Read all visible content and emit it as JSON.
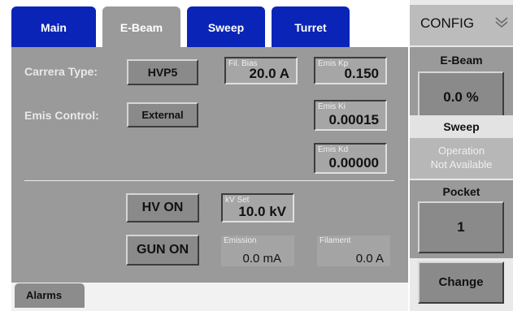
{
  "tabs": [
    {
      "label": "Main",
      "active": false
    },
    {
      "label": "E-Beam",
      "active": true
    },
    {
      "label": "Sweep",
      "active": false
    },
    {
      "label": "Turret",
      "active": false
    }
  ],
  "ebeam": {
    "carrera_label": "Carrera Type:",
    "carrera_value": "HVP5",
    "emis_control_label": "Emis Control:",
    "emis_control_value": "External",
    "fil_bias": {
      "caption": "Fil. Bias",
      "value": "20.0 A"
    },
    "emis_kp": {
      "caption": "Emis Kp",
      "value": "0.150"
    },
    "emis_ki": {
      "caption": "Emis Ki",
      "value": "0.00015"
    },
    "emis_kd": {
      "caption": "Emis Kd",
      "value": "0.00000"
    },
    "hv_on": "HV ON",
    "gun_on": "GUN ON",
    "kv_set": {
      "caption": "kV Set",
      "value": "10.0 kV"
    },
    "emission": {
      "caption": "Emission",
      "value": "0.0 mA"
    },
    "filament": {
      "caption": "Filament",
      "value": "0.0 A"
    }
  },
  "bottom": {
    "alarms_label": "Alarms"
  },
  "sidebar": {
    "config_label": "CONFIG",
    "ebeam_header": "E-Beam",
    "ebeam_value": "0.0 %",
    "sweep_header": "Sweep",
    "sweep_status_line1": "Operation",
    "sweep_status_line2": "Not Available",
    "pocket_header": "Pocket",
    "pocket_value": "1",
    "change_label": "Change"
  },
  "colors": {
    "tab_blue": "#0a24b8",
    "panel_gray": "#9a9a9a"
  }
}
